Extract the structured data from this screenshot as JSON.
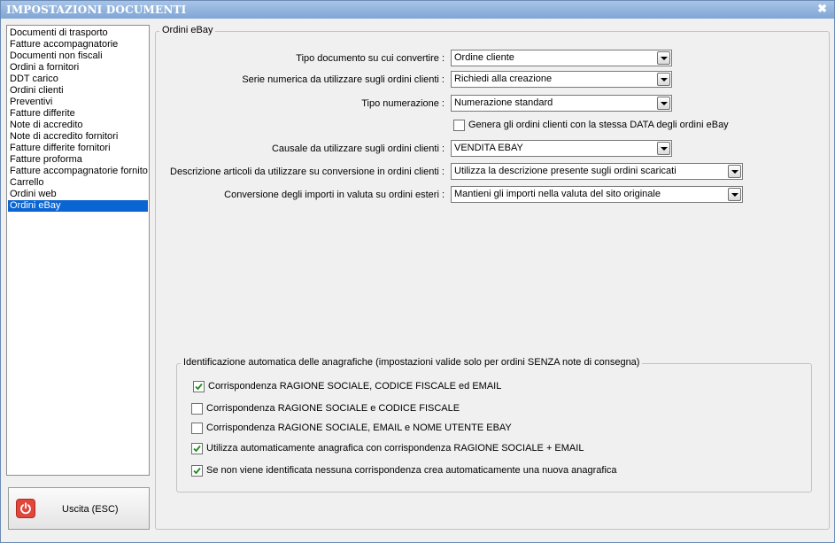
{
  "window": {
    "title": "IMPOSTAZIONI DOCUMENTI",
    "close_glyph": "✖"
  },
  "sidebar": {
    "items": [
      {
        "label": "Documenti di trasporto"
      },
      {
        "label": "Fatture accompagnatorie"
      },
      {
        "label": "Documenti non fiscali"
      },
      {
        "label": "Ordini a fornitori"
      },
      {
        "label": "DDT carico"
      },
      {
        "label": "Ordini clienti"
      },
      {
        "label": "Preventivi"
      },
      {
        "label": "Fatture differite"
      },
      {
        "label": "Note di accredito"
      },
      {
        "label": "Note di accredito fornitori"
      },
      {
        "label": "Fatture differite fornitori"
      },
      {
        "label": "Fatture proforma"
      },
      {
        "label": "Fatture accompagnatorie fornito"
      },
      {
        "label": "Carrello"
      },
      {
        "label": "Ordini web"
      },
      {
        "label": "Ordini eBay"
      }
    ],
    "selected_index": 15,
    "selection_color": "#0a64d2"
  },
  "exit_button": {
    "label": "Uscita (ESC)",
    "icon": "power-icon",
    "icon_color": "#e0473a"
  },
  "panel": {
    "legend": "Ordini eBay",
    "fields": {
      "doc_type": {
        "label": "Tipo documento su cui convertire :",
        "value": "Ordine cliente"
      },
      "series": {
        "label": "Serie numerica da utilizzare sugli ordini clienti :",
        "value": "Richiedi alla creazione"
      },
      "numbering": {
        "label": "Tipo numerazione :",
        "value": "Numerazione standard"
      },
      "same_date": {
        "label": "Genera gli ordini clienti con la stessa DATA degli ordini eBay",
        "checked": false
      },
      "causale": {
        "label": "Causale da utilizzare sugli ordini clienti :",
        "value": "VENDITA EBAY"
      },
      "description": {
        "label": "Descrizione articoli da utilizzare su conversione in ordini clienti :",
        "value": "Utilizza la descrizione presente sugli ordini scaricati"
      },
      "currency": {
        "label": "Conversione degli importi in valuta su ordini esteri :",
        "value": "Mantieni gli importi nella valuta del sito originale"
      }
    }
  },
  "identification": {
    "legend": "Identificazione automatica delle anagrafiche (impostazioni valide solo per ordini SENZA note di consegna)",
    "options": [
      {
        "label": "Corrispondenza RAGIONE SOCIALE, CODICE FISCALE ed EMAIL",
        "checked": true
      },
      {
        "label": "Corrispondenza RAGIONE SOCIALE e CODICE FISCALE",
        "checked": false
      },
      {
        "label": "Corrispondenza RAGIONE SOCIALE, EMAIL e NOME UTENTE EBAY",
        "checked": false
      },
      {
        "label": "Utilizza automaticamente anagrafica con corrispondenza RAGIONE SOCIALE + EMAIL",
        "checked": true
      },
      {
        "label": "Se non viene identificata nessuna corrispondenza crea automaticamente una nuova anagrafica",
        "checked": true
      }
    ]
  }
}
